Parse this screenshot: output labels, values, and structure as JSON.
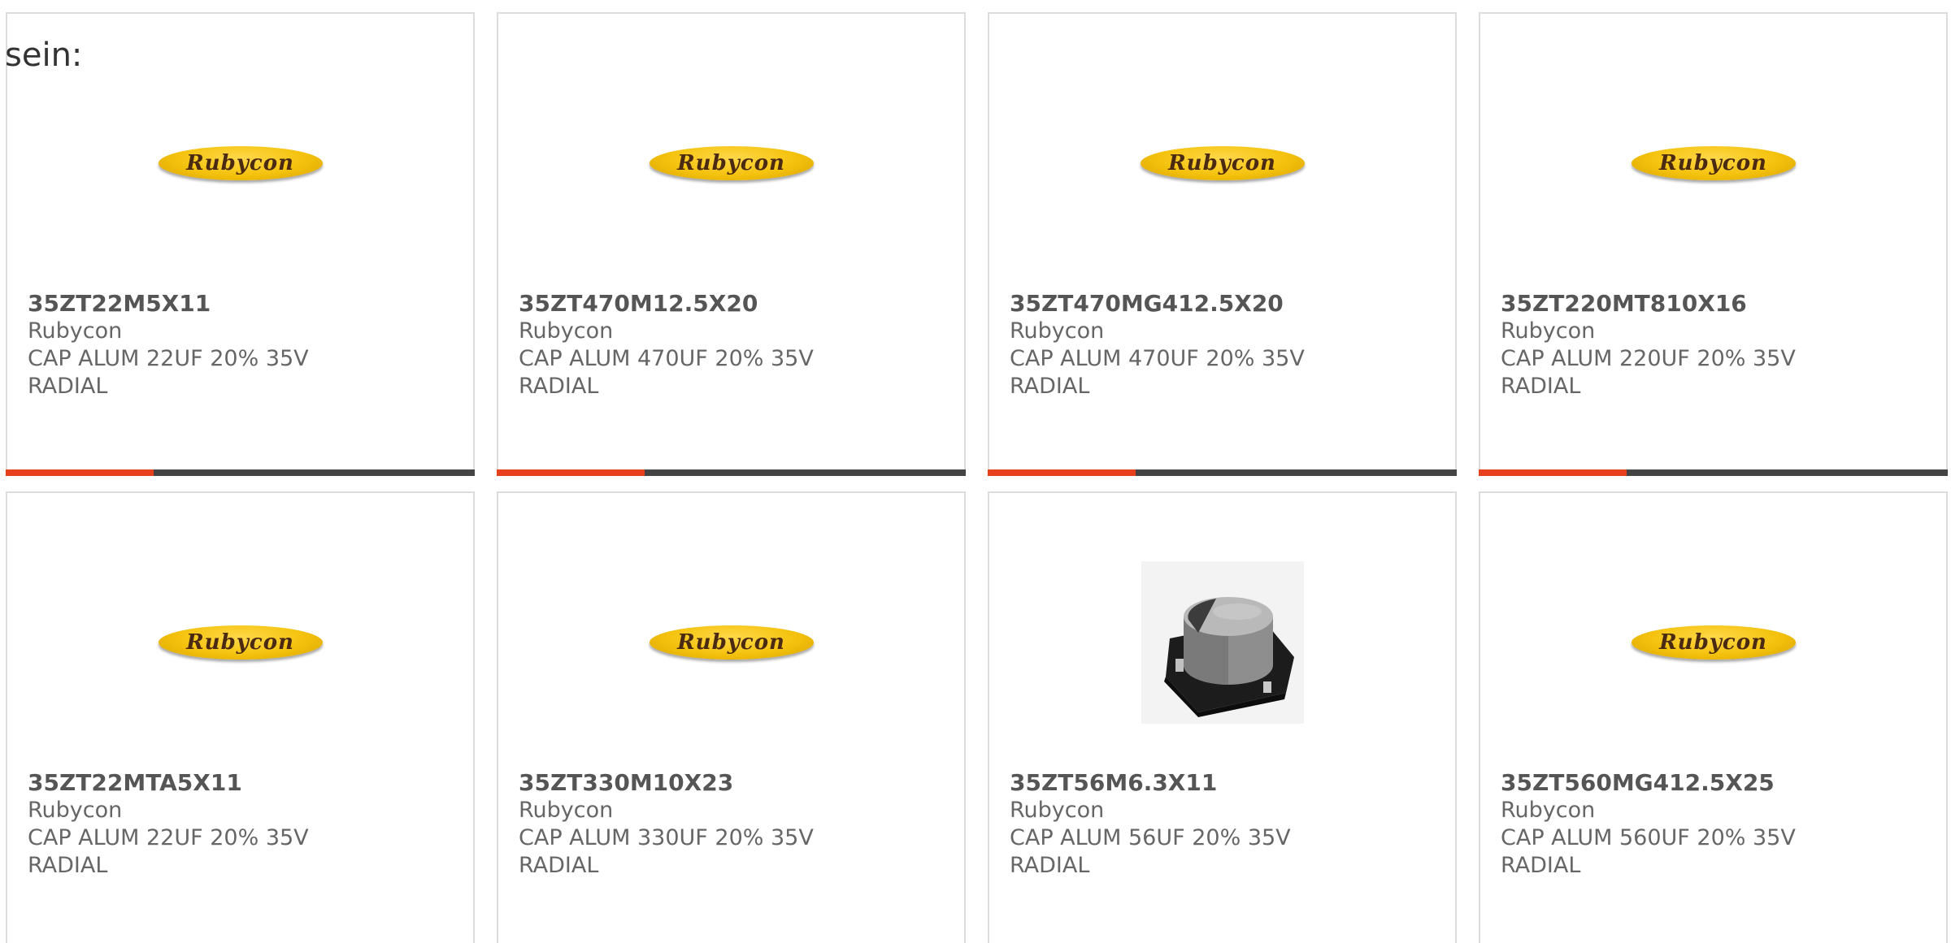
{
  "intro_text": "sein:",
  "accent_color": "#e8401c",
  "products": [
    {
      "part_number": "35ZT22M5X11",
      "manufacturer": "Rubycon",
      "desc_line1": "CAP ALUM 22UF 20% 35V",
      "desc_line2": "RADIAL",
      "image": "logo",
      "logo_text": "Rubycon"
    },
    {
      "part_number": "35ZT470M12.5X20",
      "manufacturer": "Rubycon",
      "desc_line1": "CAP ALUM 470UF 20% 35V",
      "desc_line2": "RADIAL",
      "image": "logo",
      "logo_text": "Rubycon"
    },
    {
      "part_number": "35ZT470MG412.5X20",
      "manufacturer": "Rubycon",
      "desc_line1": "CAP ALUM 470UF 20% 35V",
      "desc_line2": "RADIAL",
      "image": "logo",
      "logo_text": "Rubycon"
    },
    {
      "part_number": "35ZT220MT810X16",
      "manufacturer": "Rubycon",
      "desc_line1": "CAP ALUM 220UF 20% 35V",
      "desc_line2": "RADIAL",
      "image": "logo",
      "logo_text": "Rubycon"
    },
    {
      "part_number": "35ZT22MTA5X11",
      "manufacturer": "Rubycon",
      "desc_line1": "CAP ALUM 22UF 20% 35V",
      "desc_line2": "RADIAL",
      "image": "logo",
      "logo_text": "Rubycon"
    },
    {
      "part_number": "35ZT330M10X23",
      "manufacturer": "Rubycon",
      "desc_line1": "CAP ALUM 330UF 20% 35V",
      "desc_line2": "RADIAL",
      "image": "logo",
      "logo_text": "Rubycon"
    },
    {
      "part_number": "35ZT56M6.3X11",
      "manufacturer": "Rubycon",
      "desc_line1": "CAP ALUM 56UF 20% 35V",
      "desc_line2": "RADIAL",
      "image": "capacitor-photo"
    },
    {
      "part_number": "35ZT560MG412.5X25",
      "manufacturer": "Rubycon",
      "desc_line1": "CAP ALUM 560UF 20% 35V",
      "desc_line2": "RADIAL",
      "image": "logo",
      "logo_text": "Rubycon"
    }
  ]
}
